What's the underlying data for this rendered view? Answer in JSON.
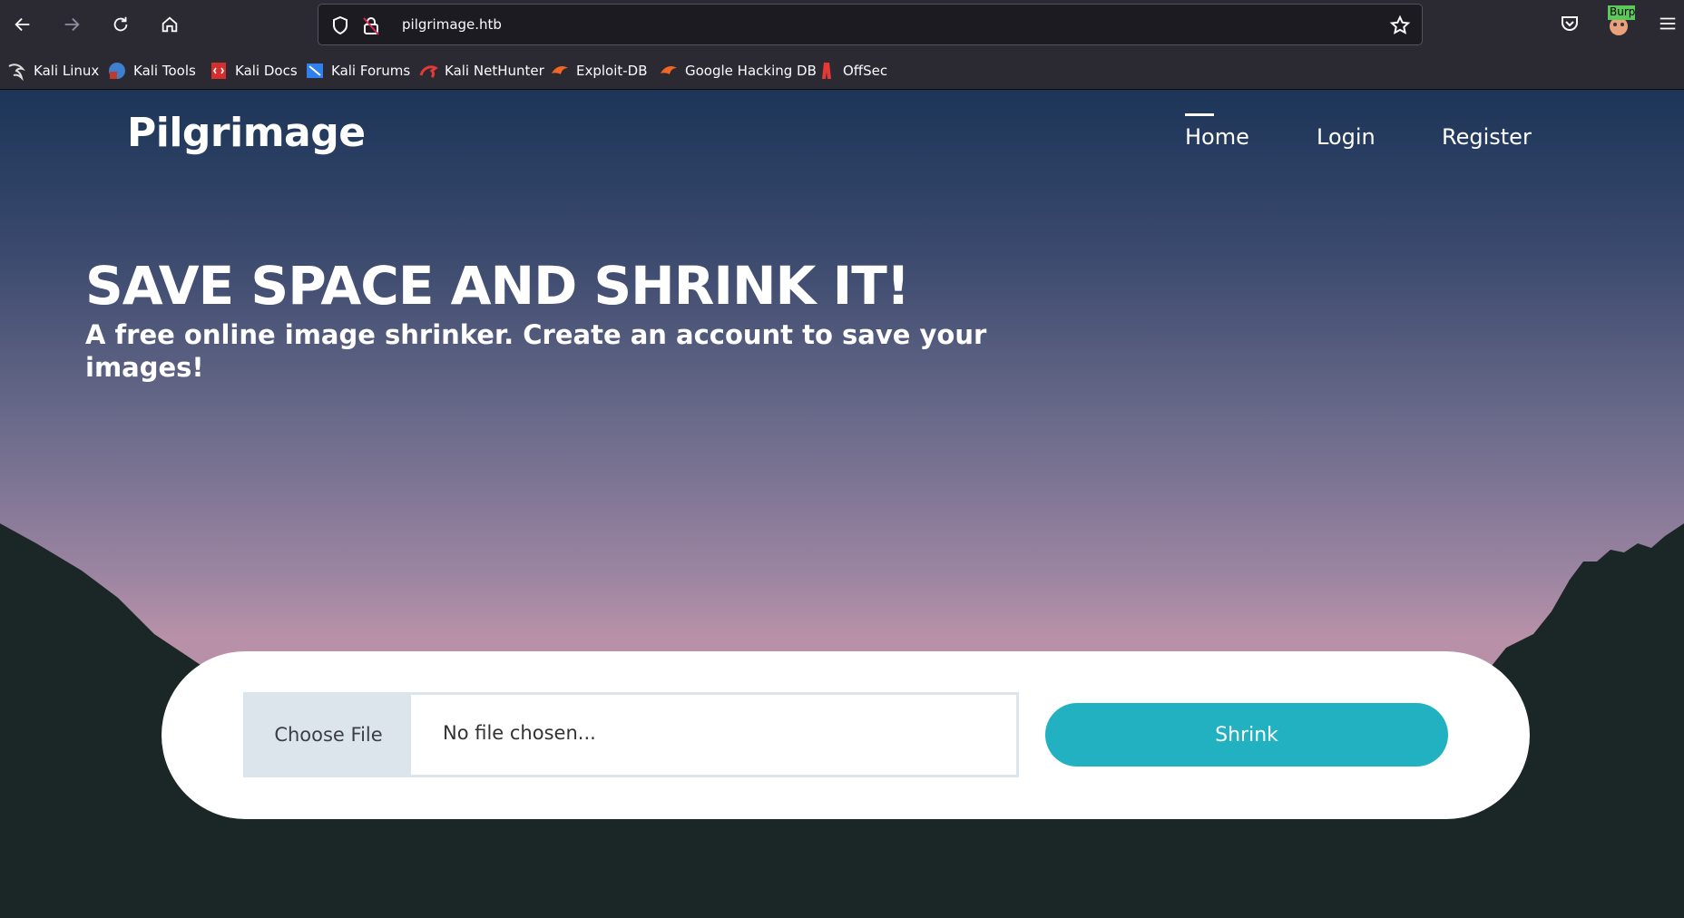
{
  "browser": {
    "url": "pilgrimage.htb",
    "bookmarks": [
      {
        "label": "Kali Linux",
        "icon": "kali-dragon-icon"
      },
      {
        "label": "Kali Tools",
        "icon": "kali-tools-icon"
      },
      {
        "label": "Kali Docs",
        "icon": "kali-docs-icon"
      },
      {
        "label": "Kali Forums",
        "icon": "kali-forums-icon"
      },
      {
        "label": "Kali NetHunter",
        "icon": "nethunter-icon"
      },
      {
        "label": "Exploit-DB",
        "icon": "exploit-db-icon"
      },
      {
        "label": "Google Hacking DB",
        "icon": "ghdb-icon"
      },
      {
        "label": "OffSec",
        "icon": "offsec-icon"
      }
    ],
    "extension_badge": "Burp"
  },
  "site": {
    "brand": "Pilgrimage",
    "nav": [
      "Home",
      "Login",
      "Register"
    ],
    "active_nav": "Home"
  },
  "hero": {
    "title": "SAVE SPACE AND SHRINK IT!",
    "subtitle": "A free online image shrinker. Create an account to save your images!"
  },
  "upload_form": {
    "choose_label": "Choose File",
    "file_label": "No file chosen...",
    "submit_label": "Shrink"
  },
  "colors": {
    "accent": "#22b1c1",
    "sky_top": "#1c3558",
    "sky_bottom": "#b891a8",
    "mountain": "#1b2626"
  }
}
